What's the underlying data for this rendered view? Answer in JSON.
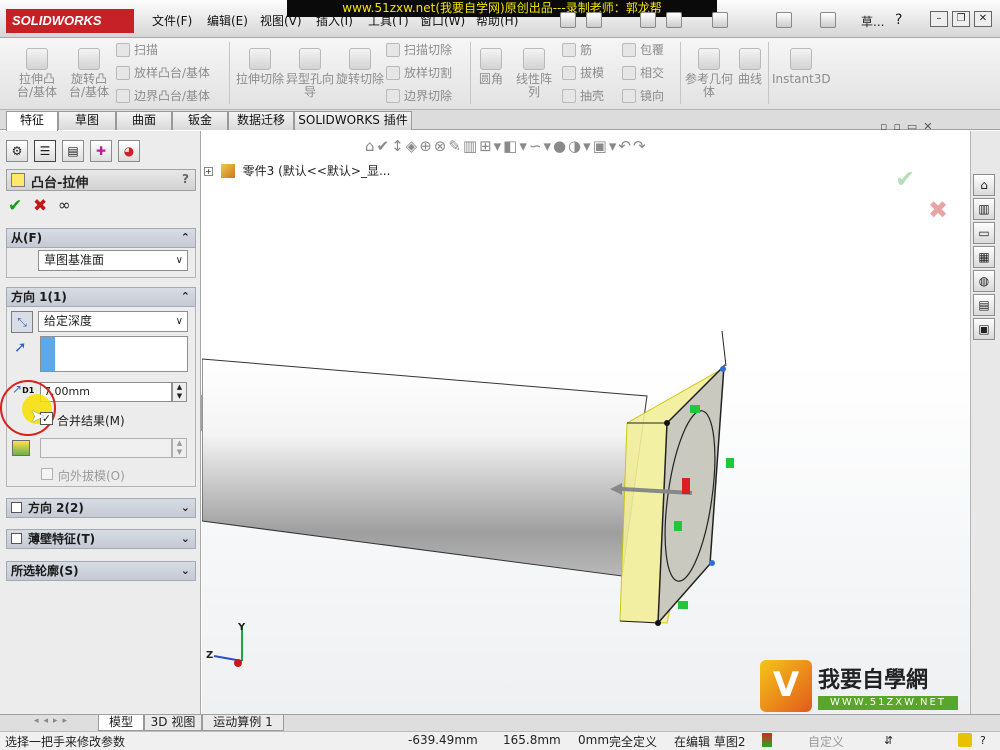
{
  "app": {
    "logo": "SOLIDWORKS",
    "watermark": "www.51zxw.net(我要自学网)原创出品---录制老师：郭龙帮"
  },
  "menu": [
    "文件(F)",
    "编辑(E)",
    "视图(V)",
    "插入(I)",
    "工具(T)",
    "窗口(W)",
    "帮助(H)"
  ],
  "search_label": "草...",
  "command_manager": {
    "big": [
      {
        "label": "拉伸凸台/基体"
      },
      {
        "label": "旋转凸台/基体"
      },
      {
        "label": "拉伸切除"
      },
      {
        "label": "异型孔向导"
      },
      {
        "label": "旋转切除"
      },
      {
        "label": "圆角"
      },
      {
        "label": "线性阵列"
      },
      {
        "label": "参考几何体"
      },
      {
        "label": "曲线"
      },
      {
        "label": "Instant3D"
      }
    ],
    "small_col1": [
      "扫描",
      "放样凸台/基体",
      "边界凸台/基体"
    ],
    "small_col2": [
      "扫描切除",
      "放样切割",
      "边界切除"
    ],
    "small_col3": [
      "筋",
      "拔模",
      "抽壳"
    ],
    "small_col4": [
      "包覆",
      "相交",
      "镜向"
    ]
  },
  "tabs": [
    "特征",
    "草图",
    "曲面",
    "钣金",
    "数据迁移",
    "SOLIDWORKS 插件"
  ],
  "feature_tree": {
    "root": "零件3 (默认<<默认>_显..."
  },
  "property_manager": {
    "title": "凸台-拉伸",
    "help": "?",
    "from_section": {
      "title": "从(F)",
      "value": "草图基准面"
    },
    "direction1": {
      "title": "方向 1(1)",
      "end_condition": "给定深度",
      "depth_label": "D1",
      "depth": "7.00mm",
      "merge_label": "合并结果(M)",
      "draft_outward": "向外拔模(O)"
    },
    "direction2": {
      "title": "方向 2(2)"
    },
    "thin": {
      "title": "薄壁特征(T)"
    },
    "contours": {
      "title": "所选轮廓(S)"
    }
  },
  "bottom_tabs": [
    "模型",
    "3D 视图",
    "运动算例 1"
  ],
  "status": {
    "message": "选择一把手来修改参数",
    "x": "-639.49mm",
    "y": "165.8mm",
    "z": "0mm",
    "state": "完全定义",
    "editing": "在编辑 草图2",
    "custom": "自定义"
  },
  "watermark_logo": {
    "title": "我要自學網",
    "url": "WWW.51ZXW.NET"
  },
  "triad": {
    "z": "Z",
    "y": "Y"
  },
  "colors": {
    "accent_red": "#c62127",
    "feature_yellow": "#f2ef9a",
    "cylinder": "#d9d9d9"
  }
}
